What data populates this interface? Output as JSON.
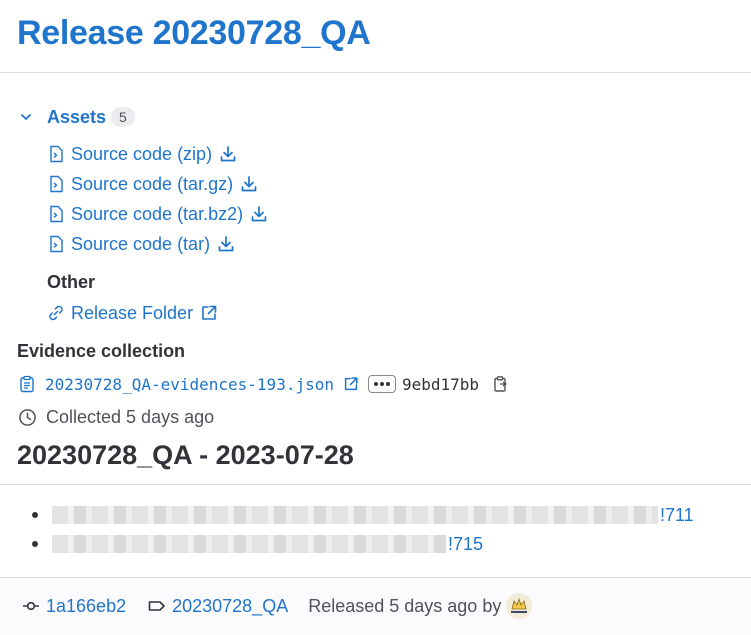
{
  "page": {
    "title": "Release 20230728_QA"
  },
  "assets": {
    "label": "Assets",
    "count": "5",
    "sources": [
      {
        "label": "Source code (zip)",
        "icon": "doc-code-icon"
      },
      {
        "label": "Source code (tar.gz)",
        "icon": "doc-code-icon"
      },
      {
        "label": "Source code (tar.bz2)",
        "icon": "doc-code-icon"
      },
      {
        "label": "Source code (tar)",
        "icon": "doc-code-icon"
      }
    ],
    "other_label": "Other",
    "other_links": [
      {
        "label": "Release Folder",
        "icon": "link-icon"
      }
    ]
  },
  "evidence": {
    "title": "Evidence collection",
    "file": "20230728_QA-evidences-193.json",
    "sha": "9ebd17bb",
    "collected": "Collected 5 days ago"
  },
  "notes": {
    "heading": "20230728_QA - 2023-07-28",
    "items": [
      {
        "mr": "!711"
      },
      {
        "mr": "!715"
      }
    ]
  },
  "footer": {
    "commit": "1a166eb2",
    "tag": "20230728_QA",
    "released": "Released 5 days ago by"
  },
  "colors": {
    "link": "#1f75cb",
    "text": "#333238",
    "muted": "#535158"
  }
}
